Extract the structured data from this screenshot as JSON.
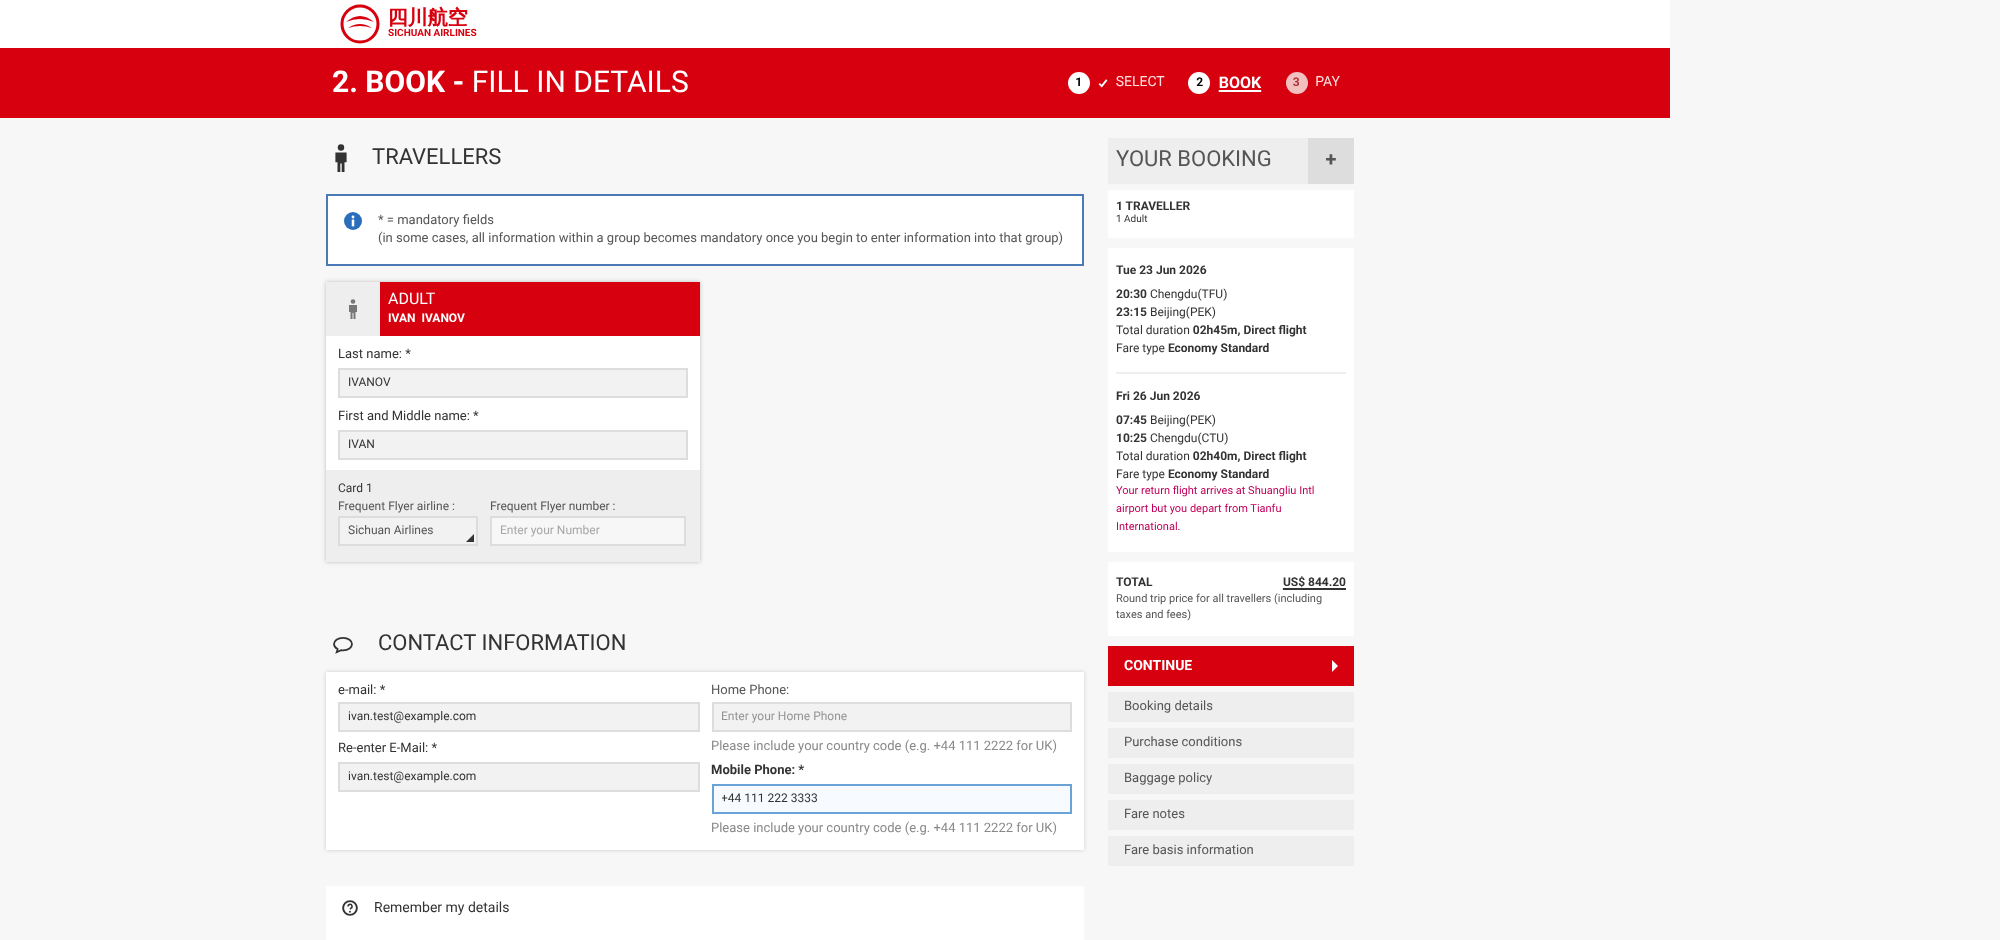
{
  "brand": {
    "chinese": "四川航空",
    "english": "SICHUAN AIRLINES"
  },
  "page_title": {
    "step": "2. BOOK -",
    "title": "FILL IN DETAILS"
  },
  "steps": [
    {
      "number": "1",
      "label": "SELECT",
      "done": true,
      "selected": false
    },
    {
      "number": "2",
      "label": "BOOK",
      "done": false,
      "selected": true
    },
    {
      "number": "3",
      "label": "PAY",
      "done": false,
      "selected": false
    }
  ],
  "travellers": {
    "heading": "TRAVELLERS",
    "info": {
      "title": "* = mandatory fields",
      "text": "(in some cases, all information within a group becomes mandatory once you begin to enter information into that group)"
    },
    "passenger": {
      "type": "ADULT",
      "name": "IVAN  IVANOV",
      "fields": [
        {
          "label": "Last name: *",
          "value": "IVANOV"
        },
        {
          "label": "First and Middle name: *",
          "value": "IVAN"
        }
      ],
      "card": {
        "title": "Card 1",
        "airline_label": "Frequent Flyer airline :",
        "airline_value": "Sichuan Airlines",
        "number_label": "Frequent Flyer number :",
        "number_placeholder": "Enter your Number"
      }
    }
  },
  "contact": {
    "heading": "CONTACT INFORMATION",
    "left": [
      {
        "label": "e-mail: *",
        "value": "ivan.test@example.com"
      },
      {
        "label": "Re-enter E-Mail: *",
        "value": "ivan.test@example.com"
      }
    ],
    "right": [
      {
        "label": "Home Phone:",
        "placeholder": "Enter your Home Phone",
        "hint": "Please include your country code (e.g. +44 111 2222 for UK)",
        "focused": false
      },
      {
        "label": "Mobile Phone: *",
        "value": "+44 111 222 3333",
        "hint": "Please include your country code (e.g. +44 111 2222 for UK)",
        "focused": true
      }
    ]
  },
  "remember": {
    "heading": "Remember my details"
  },
  "booking": {
    "heading": "YOUR BOOKING",
    "expand": "+",
    "travellers": {
      "count": "1 TRAVELLER",
      "detail": "1 Adult"
    },
    "flights": [
      {
        "date": "Tue 23 Jun 2026",
        "segments": [
          "**20:30** Chengdu(TFU)",
          "**23:15** Beijing(PEK)"
        ],
        "duration": "Total duration **02h45m, Direct flight**",
        "fare": "Fare type **Economy Standard**"
      },
      {
        "date": "Fri 26 Jun 2026",
        "segments": [
          "**07:45** Beijing(PEK)",
          "**10:25** Chengdu(CTU)"
        ],
        "duration": "Total duration **02h40m, Direct flight**",
        "fare": "Fare type **Economy Standard**",
        "warning": "Your return flight arrives at Shuangliu Intl airport but you depart from Tianfu International."
      }
    ],
    "total": {
      "label": "TOTAL",
      "amount": "US$ 844.20",
      "note": "Round trip price for all travellers (including taxes and fees)"
    },
    "continue": "CONTINUE",
    "links": [
      "Booking details",
      "Purchase conditions",
      "Baggage policy",
      "Fare notes",
      "Fare basis information"
    ]
  }
}
